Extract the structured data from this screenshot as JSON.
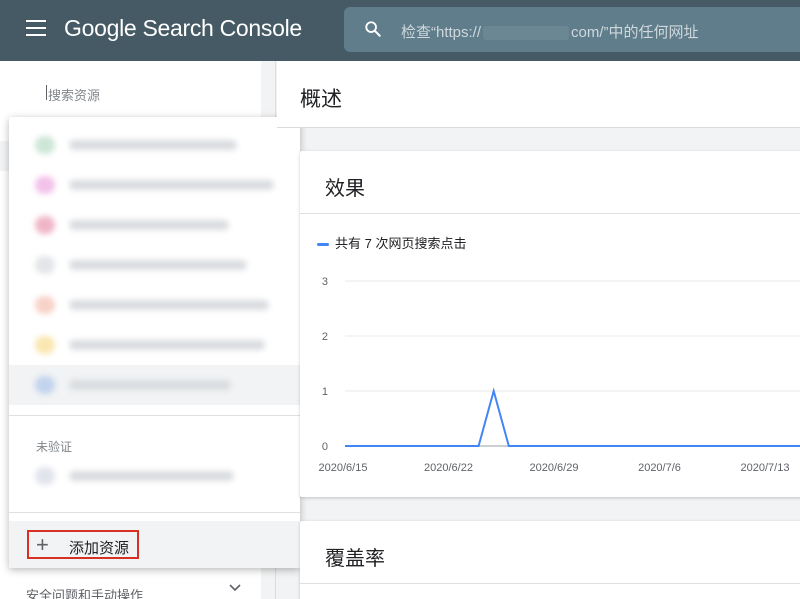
{
  "header": {
    "app_title": "Google Search Console",
    "menu_icon": "hamburger-menu-icon",
    "search_icon": "search-icon",
    "search_prefix": "检查“https://",
    "search_suffix": "com/”中的任何网址"
  },
  "sidebar": {
    "property_search_placeholder": "搜索资源",
    "bottom_item": "安全问题和手动操作",
    "bottom_item_icon": "chevron-down-icon"
  },
  "dropdown": {
    "verified_properties": [
      {
        "color": "#cde6d6"
      },
      {
        "color": "#f3c2ea"
      },
      {
        "color": "#f0b6c8"
      },
      {
        "color": "#e3e5e8"
      },
      {
        "color": "#f7d2c8"
      },
      {
        "color": "#fae6b0"
      },
      {
        "color": "#c2d3ee",
        "selected": true
      }
    ],
    "unverified_label": "未验证",
    "unverified_properties": [
      {
        "color": "#e1e4ec"
      }
    ],
    "add_property_icon": "plus-icon",
    "add_property_label": "添加资源"
  },
  "main": {
    "page_title": "概述",
    "performance": {
      "title": "效果",
      "legend": "共有 7 次网页搜索点击",
      "accent_color": "#4285f4"
    },
    "coverage": {
      "title": "覆盖率"
    }
  },
  "chart_data": {
    "type": "line",
    "title": "",
    "xlabel": "",
    "ylabel": "",
    "ylim": [
      0,
      3
    ],
    "yticks": [
      0,
      1,
      2,
      3
    ],
    "x_tick_labels": [
      "2020/6/15",
      "2020/6/22",
      "2020/6/29",
      "2020/7/6",
      "2020/7/13"
    ],
    "grid": true,
    "series": [
      {
        "name": "共有 7 次网页搜索点击",
        "color": "#4285f4",
        "x": [
          "2020/6/14",
          "2020/6/24",
          "2020/6/25",
          "2020/6/26",
          "2020/7/17"
        ],
        "y": [
          0,
          0,
          1,
          0,
          0
        ]
      }
    ]
  }
}
